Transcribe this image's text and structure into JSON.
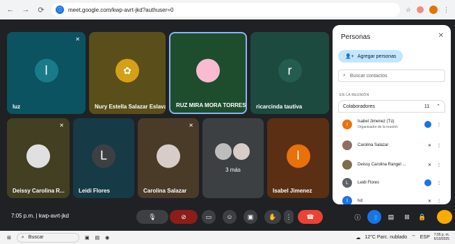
{
  "browser": {
    "url": "meet.google.com/kwp-avrt-jkd?authuser=0"
  },
  "meet": {
    "time": "7:05 p.m.",
    "meeting_code": "kwp-avrt-jkd",
    "more_label": "3 más",
    "tiles": [
      {
        "name": "luz",
        "letter": "l",
        "bg": "#0b5360",
        "ava_bg": "#1a7a8a"
      },
      {
        "name": "Nury Estella Salazar Eslava",
        "letter": "",
        "bg": "#5a4f1a",
        "ava_bg": "#8b7b25"
      },
      {
        "name": "RUZ MIRA MORA TORRES",
        "letter": "",
        "bg": "#1e4d2e",
        "ava_bg": "#2f6a42"
      },
      {
        "name": "ricarcinda tautiva",
        "letter": "r",
        "bg": "#1d4a3e",
        "ava_bg": "#245c50"
      },
      {
        "name": "Deissy Carolina R...",
        "letter": "",
        "bg": "#423f22",
        "ava_bg": "#6a6438"
      },
      {
        "name": "Leidi Flores",
        "letter": "L",
        "bg": "#163a46",
        "ava_bg": "#3c4043"
      },
      {
        "name": "Carolina Salazar",
        "letter": "",
        "bg": "#4a3a28",
        "ava_bg": "#6b5a44"
      },
      {
        "name": "Isabel Jimenez",
        "letter": "I",
        "bg": "#5a2f14",
        "ava_bg": "#e8710a"
      }
    ]
  },
  "panel": {
    "title": "Personas",
    "add_people": "Agregar personas",
    "search_placeholder": "Buscar contactos",
    "section": "EN LA REUNIÓN",
    "group": "Colaboradores",
    "group_count": "11",
    "people": [
      {
        "name": "Isabel Jimenez (Tú)",
        "sub": "Organizador de la reunión",
        "letter": "I",
        "bg": "#e8710a"
      },
      {
        "name": "Carolina Salazar",
        "sub": "",
        "letter": "",
        "bg": "#8d6e63"
      },
      {
        "name": "Deissy Carolina Rangel ...",
        "sub": "",
        "letter": "",
        "bg": "#7b6f4a"
      },
      {
        "name": "Leidi Flores",
        "sub": "",
        "letter": "L",
        "bg": "#5f6368"
      },
      {
        "name": "luz",
        "sub": "",
        "letter": "l",
        "bg": "#1a73e8"
      }
    ]
  },
  "taskbar": {
    "search_placeholder": "Buscar",
    "weather": "12°C Parc. nublado",
    "lang": "ESP",
    "clock_time": "7:05 p. m.",
    "clock_date": "6/10/2025"
  }
}
